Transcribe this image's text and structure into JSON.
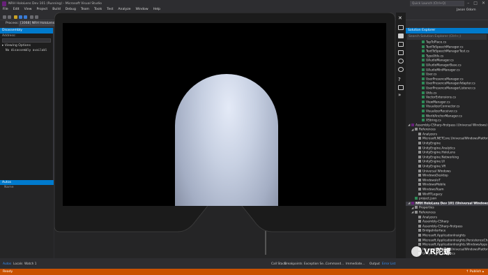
{
  "window": {
    "title": "NRH HoloLens Dev 101 (Running) - Microsoft Visual Studio",
    "quick_launch_placeholder": "Quick Launch (Ctrl+Q)",
    "user": "Jason Odom"
  },
  "menu": [
    "File",
    "Edit",
    "View",
    "Project",
    "Build",
    "Debug",
    "Team",
    "Tools",
    "Test",
    "Analyze",
    "Window",
    "Help"
  ],
  "process": {
    "label": "Process:",
    "value": "[3068] NRH HoloLens Dev"
  },
  "disassembly": {
    "tab": "Disassembly",
    "address_label": "Address:",
    "viewing_options": "Viewing Options",
    "message": "No disassembly availabl"
  },
  "autos": {
    "tab": "Autos",
    "column_name": "Name"
  },
  "solution_explorer": {
    "title": "Solution Explorer",
    "search_placeholder": "Search Solution Explorer (Ctrl+;)",
    "items": [
      {
        "label": "TapToPlace.cs",
        "kind": "file",
        "level": 3
      },
      {
        "label": "TextToSpeechManager.cs",
        "kind": "file",
        "level": 3
      },
      {
        "label": "TextToSpeechManagerTest.cs",
        "kind": "file",
        "level": 3
      },
      {
        "label": "TypeUtils.cs",
        "kind": "file",
        "level": 3
      },
      {
        "label": "UAudioManager.cs",
        "kind": "file",
        "level": 3
      },
      {
        "label": "UAudioManagerBase.cs",
        "kind": "file",
        "level": 3
      },
      {
        "label": "UAudioMiniManager.cs",
        "kind": "file",
        "level": 3
      },
      {
        "label": "User.cs",
        "kind": "file",
        "level": 3
      },
      {
        "label": "UserPresenceManager.cs",
        "kind": "file",
        "level": 3
      },
      {
        "label": "UserPresenceManagerAdapter.cs",
        "kind": "file",
        "level": 3
      },
      {
        "label": "UserPresenceManagerListener.cs",
        "kind": "file",
        "level": 3
      },
      {
        "label": "Utils.cs",
        "kind": "file",
        "level": 3
      },
      {
        "label": "VectorExtensions.cs",
        "kind": "file",
        "level": 3
      },
      {
        "label": "ViewManager.cs",
        "kind": "file",
        "level": 3
      },
      {
        "label": "VisualizerConnector.cs",
        "kind": "file",
        "level": 3
      },
      {
        "label": "VisualizerReceiver.cs",
        "kind": "file",
        "level": 3
      },
      {
        "label": "WorldAnchorManager.cs",
        "kind": "file",
        "level": 3
      },
      {
        "label": "XString.cs",
        "kind": "file",
        "level": 3
      },
      {
        "label": "Assembly-CSharp-firstpass (Universal Windows)",
        "kind": "project",
        "level": 0
      },
      {
        "label": "References",
        "kind": "ref",
        "level": 1
      },
      {
        "label": "Analyzers",
        "kind": "ref",
        "level": 2
      },
      {
        "label": "Microsoft.NETCore.UniversalWindowsPlatform",
        "kind": "ref",
        "level": 2
      },
      {
        "label": "UnityEngine",
        "kind": "ref",
        "level": 2
      },
      {
        "label": "UnityEngine.Analytics",
        "kind": "ref",
        "level": 2
      },
      {
        "label": "UnityEngine.HoloLens",
        "kind": "ref",
        "level": 2
      },
      {
        "label": "UnityEngine.Networking",
        "kind": "ref",
        "level": 2
      },
      {
        "label": "UnityEngine.UI",
        "kind": "ref",
        "level": 2
      },
      {
        "label": "UnityEngine.VR",
        "kind": "ref",
        "level": 2
      },
      {
        "label": "Universal Windows",
        "kind": "ref",
        "level": 2
      },
      {
        "label": "WindowsDesktop",
        "kind": "ref",
        "level": 2
      },
      {
        "label": "WindowsIoT",
        "kind": "ref",
        "level": 2
      },
      {
        "label": "WindowsMobile",
        "kind": "ref",
        "level": 2
      },
      {
        "label": "WindowsTeam",
        "kind": "ref",
        "level": 2
      },
      {
        "label": "WinRTLegacy",
        "kind": "ref",
        "level": 2
      },
      {
        "label": "project.json",
        "kind": "file",
        "level": 1
      },
      {
        "label": "NRH HoloLens Dev 101 (Universal Windows)",
        "kind": "project",
        "level": 0,
        "selected": true
      },
      {
        "label": "Properties",
        "kind": "ref",
        "level": 1
      },
      {
        "label": "References",
        "kind": "ref",
        "level": 1
      },
      {
        "label": "Analyzers",
        "kind": "ref",
        "level": 2
      },
      {
        "label": "Assembly-CSharp",
        "kind": "ref",
        "level": 2
      },
      {
        "label": "Assembly-CSharp-firstpass",
        "kind": "ref",
        "level": 2
      },
      {
        "label": "BridgeInterface",
        "kind": "ref",
        "level": 2
      },
      {
        "label": "Microsoft.ApplicationInsights",
        "kind": "ref",
        "level": 2
      },
      {
        "label": "Microsoft.ApplicationInsights.PersistenceChannel",
        "kind": "ref",
        "level": 2
      },
      {
        "label": "Microsoft.ApplicationInsights.WindowsApps",
        "kind": "ref",
        "level": 2
      },
      {
        "label": "Microsoft.NETCore.UniversalWindowsPlatform",
        "kind": "ref",
        "level": 2
      },
      {
        "label": "UnityEngine.Analytics",
        "kind": "ref",
        "level": 2
      }
    ]
  },
  "bottom_tabs_left": [
    "Autos",
    "Locals",
    "Watch 1"
  ],
  "bottom_tabs_right": [
    "Call Stack",
    "Breakpoints",
    "Exception Se...",
    "Command...",
    "Immediate...",
    "Output",
    "Error List"
  ],
  "status": {
    "left": "Ready",
    "right": "↑ Publish ▴"
  },
  "watermark": {
    "text": "VR陀螺"
  },
  "colors": {
    "accent": "#007acc",
    "status_bar": "#ca5100",
    "viewport_bg": "#000000",
    "hmd_frame": "#1b1b1b"
  }
}
